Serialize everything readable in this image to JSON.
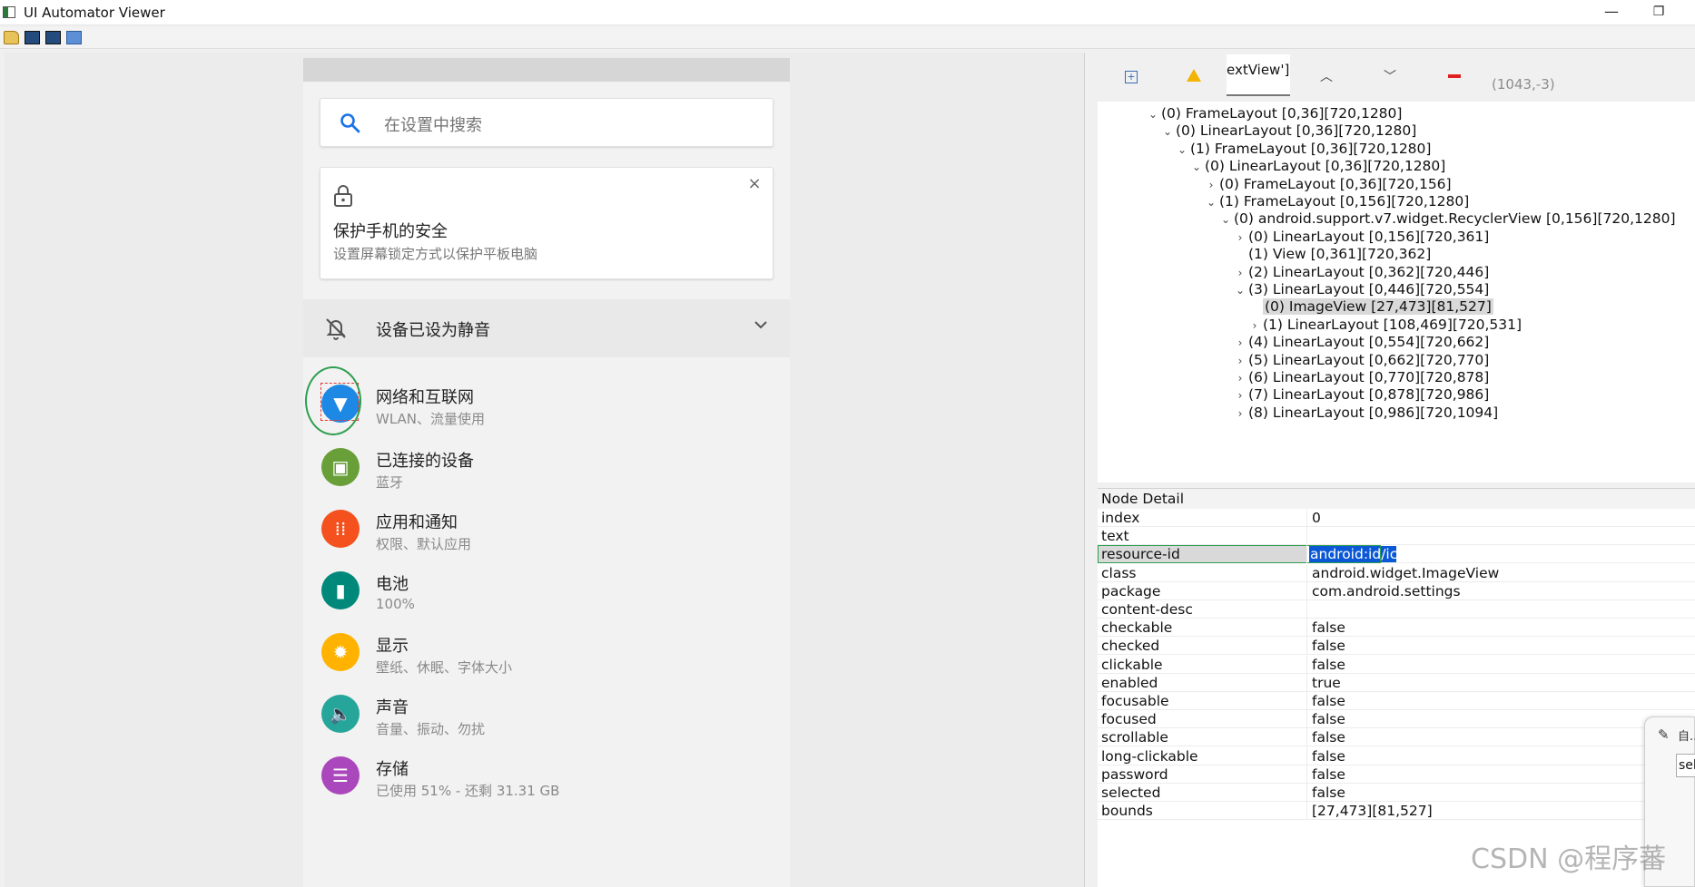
{
  "window": {
    "title": "UI Automator Viewer",
    "min_glyph": "—",
    "max_glyph": "❐"
  },
  "phone": {
    "search_placeholder": "在设置中搜索",
    "security_card": {
      "title": "保护手机的安全",
      "subtitle": "设置屏幕锁定方式以保护平板电脑",
      "close": "×"
    },
    "mute": {
      "label": "设备已设为静音"
    },
    "items": [
      {
        "title": "网络和互联网",
        "subtitle": "WLAN、流量使用",
        "color": "#1e88e5",
        "icon": "wifi-icon"
      },
      {
        "title": "已连接的设备",
        "subtitle": "蓝牙",
        "color": "#689f38",
        "icon": "devices-icon"
      },
      {
        "title": "应用和通知",
        "subtitle": "权限、默认应用",
        "color": "#f4511e",
        "icon": "apps-icon"
      },
      {
        "title": "电池",
        "subtitle": "100%",
        "color": "#00897b",
        "icon": "battery-icon"
      },
      {
        "title": "显示",
        "subtitle": "壁纸、休眠、字体大小",
        "color": "#ffb300",
        "icon": "display-icon"
      },
      {
        "title": "声音",
        "subtitle": "音量、振动、勿扰",
        "color": "#26a69a",
        "icon": "sound-icon"
      },
      {
        "title": "存储",
        "subtitle": "已使用 51% - 还剩 31.31 GB",
        "color": "#ab47bc",
        "icon": "storage-icon"
      }
    ]
  },
  "tree_toolbar": {
    "filter_text": "extView']",
    "coords": "(1043,-3)"
  },
  "tree": [
    {
      "label": "(0) FrameLayout [0,36][720,1280]",
      "chev": "⌄",
      "indent": 0
    },
    {
      "label": "(0) LinearLayout [0,36][720,1280]",
      "chev": "⌄",
      "indent": 1
    },
    {
      "label": "(1) FrameLayout [0,36][720,1280]",
      "chev": "⌄",
      "indent": 2
    },
    {
      "label": "(0) LinearLayout [0,36][720,1280]",
      "chev": "⌄",
      "indent": 3
    },
    {
      "label": "(0) FrameLayout [0,36][720,156]",
      "chev": "›",
      "indent": 4
    },
    {
      "label": "(1) FrameLayout [0,156][720,1280]",
      "chev": "⌄",
      "indent": 4
    },
    {
      "label": "(0) android.support.v7.widget.RecyclerView [0,156][720,1280]",
      "chev": "⌄",
      "indent": 5
    },
    {
      "label": "(0) LinearLayout [0,156][720,361]",
      "chev": "›",
      "indent": 6
    },
    {
      "label": "(1) View [0,361][720,362]",
      "chev": "",
      "indent": 6
    },
    {
      "label": "(2) LinearLayout [0,362][720,446]",
      "chev": "›",
      "indent": 6
    },
    {
      "label": "(3) LinearLayout [0,446][720,554]",
      "chev": "⌄",
      "indent": 6
    },
    {
      "label": "(0) ImageView [27,473][81,527]",
      "chev": "",
      "indent": 7,
      "selected": true
    },
    {
      "label": "(1) LinearLayout [108,469][720,531]",
      "chev": "›",
      "indent": 7
    },
    {
      "label": "(4) LinearLayout [0,554][720,662]",
      "chev": "›",
      "indent": 6
    },
    {
      "label": "(5) LinearLayout [0,662][720,770]",
      "chev": "›",
      "indent": 6
    },
    {
      "label": "(6) LinearLayout [0,770][720,878]",
      "chev": "›",
      "indent": 6
    },
    {
      "label": "(7) LinearLayout [0,878][720,986]",
      "chev": "›",
      "indent": 6
    },
    {
      "label": "(8) LinearLayout [0,986][720,1094]",
      "chev": "›",
      "indent": 6
    }
  ],
  "detail": {
    "title": "Node Detail",
    "rows": [
      {
        "key": "index",
        "value": "0"
      },
      {
        "key": "text",
        "value": ""
      },
      {
        "key": "resource-id",
        "value": "android:id/icon"
      },
      {
        "key": "class",
        "value": "android.widget.ImageView"
      },
      {
        "key": "package",
        "value": "com.android.settings"
      },
      {
        "key": "content-desc",
        "value": ""
      },
      {
        "key": "checkable",
        "value": "false"
      },
      {
        "key": "checked",
        "value": "false"
      },
      {
        "key": "clickable",
        "value": "false"
      },
      {
        "key": "enabled",
        "value": "true"
      },
      {
        "key": "focusable",
        "value": "false"
      },
      {
        "key": "focused",
        "value": "false"
      },
      {
        "key": "scrollable",
        "value": "false"
      },
      {
        "key": "long-clickable",
        "value": "false"
      },
      {
        "key": "password",
        "value": "false"
      },
      {
        "key": "selected",
        "value": "false"
      },
      {
        "key": "bounds",
        "value": "[27,473][81,527]"
      }
    ]
  },
  "popup": {
    "text": "自...",
    "input": "sel"
  },
  "watermark": "CSDN @程序蕃"
}
